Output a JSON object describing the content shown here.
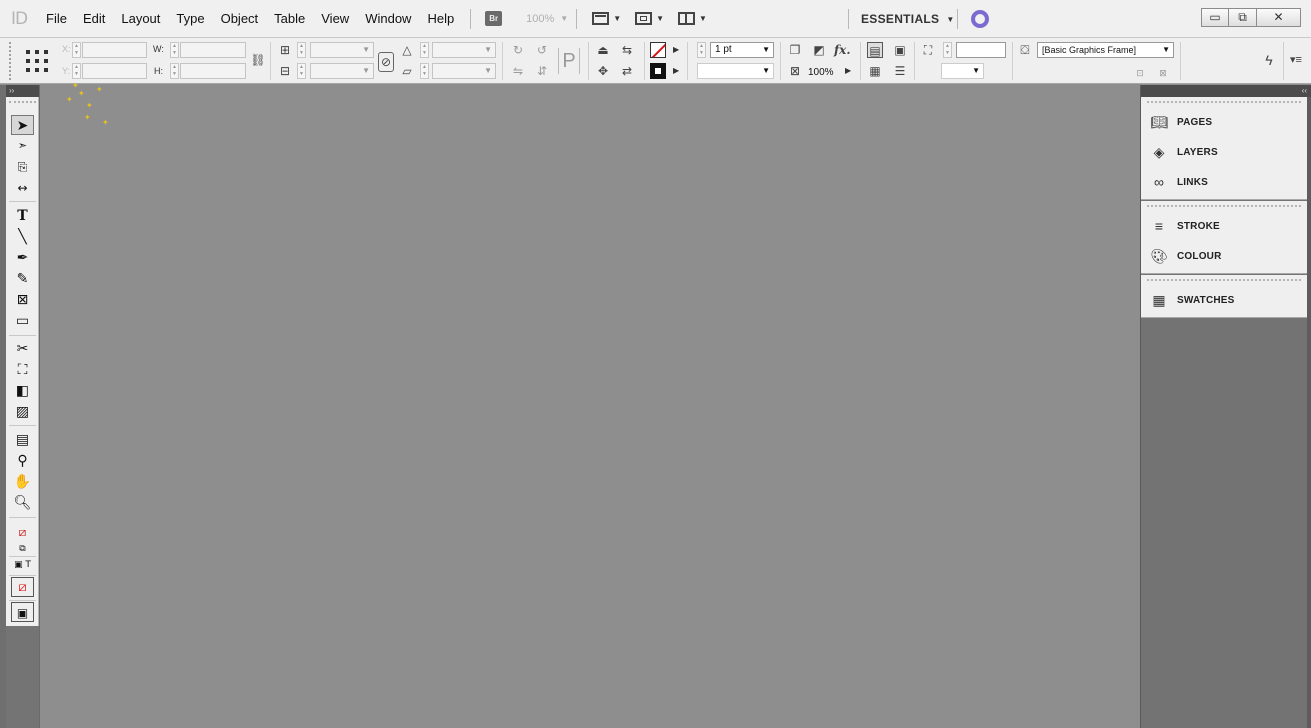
{
  "app": {
    "logo": "ID"
  },
  "menu": [
    "File",
    "Edit",
    "Layout",
    "Type",
    "Object",
    "Table",
    "View",
    "Window",
    "Help"
  ],
  "bridge_label": "Br",
  "zoom": {
    "value": "100%"
  },
  "workspace": {
    "label": "ESSENTIALS"
  },
  "window_controls": {
    "minimize": "▭",
    "restore": "⧉",
    "close": "✕"
  },
  "control_panel": {
    "x_label": "X:",
    "y_label": "Y:",
    "w_label": "W:",
    "h_label": "H:",
    "stroke_weight": "1 pt",
    "opacity": "100%",
    "object_style": "[Basic Graphics Frame]",
    "fx_label": "fx."
  },
  "tools_panel": {
    "collapse": "››"
  },
  "dock": {
    "collapse": "‹‹",
    "groups": [
      {
        "items": [
          {
            "icon": "pages-icon",
            "label": "PAGES"
          },
          {
            "icon": "layers-icon",
            "label": "LAYERS"
          },
          {
            "icon": "links-icon",
            "label": "LINKS"
          }
        ]
      },
      {
        "items": [
          {
            "icon": "stroke-icon",
            "label": "STROKE"
          },
          {
            "icon": "colour-icon",
            "label": "COLOUR"
          }
        ]
      },
      {
        "items": [
          {
            "icon": "swatches-icon",
            "label": "SWATCHES"
          }
        ]
      }
    ]
  },
  "colors": {
    "menubar_bg": "#f0f0f0",
    "canvas_bg": "#8e8e8e",
    "panel_bg": "#efefef",
    "sync_accent": "#7a6bd0"
  }
}
